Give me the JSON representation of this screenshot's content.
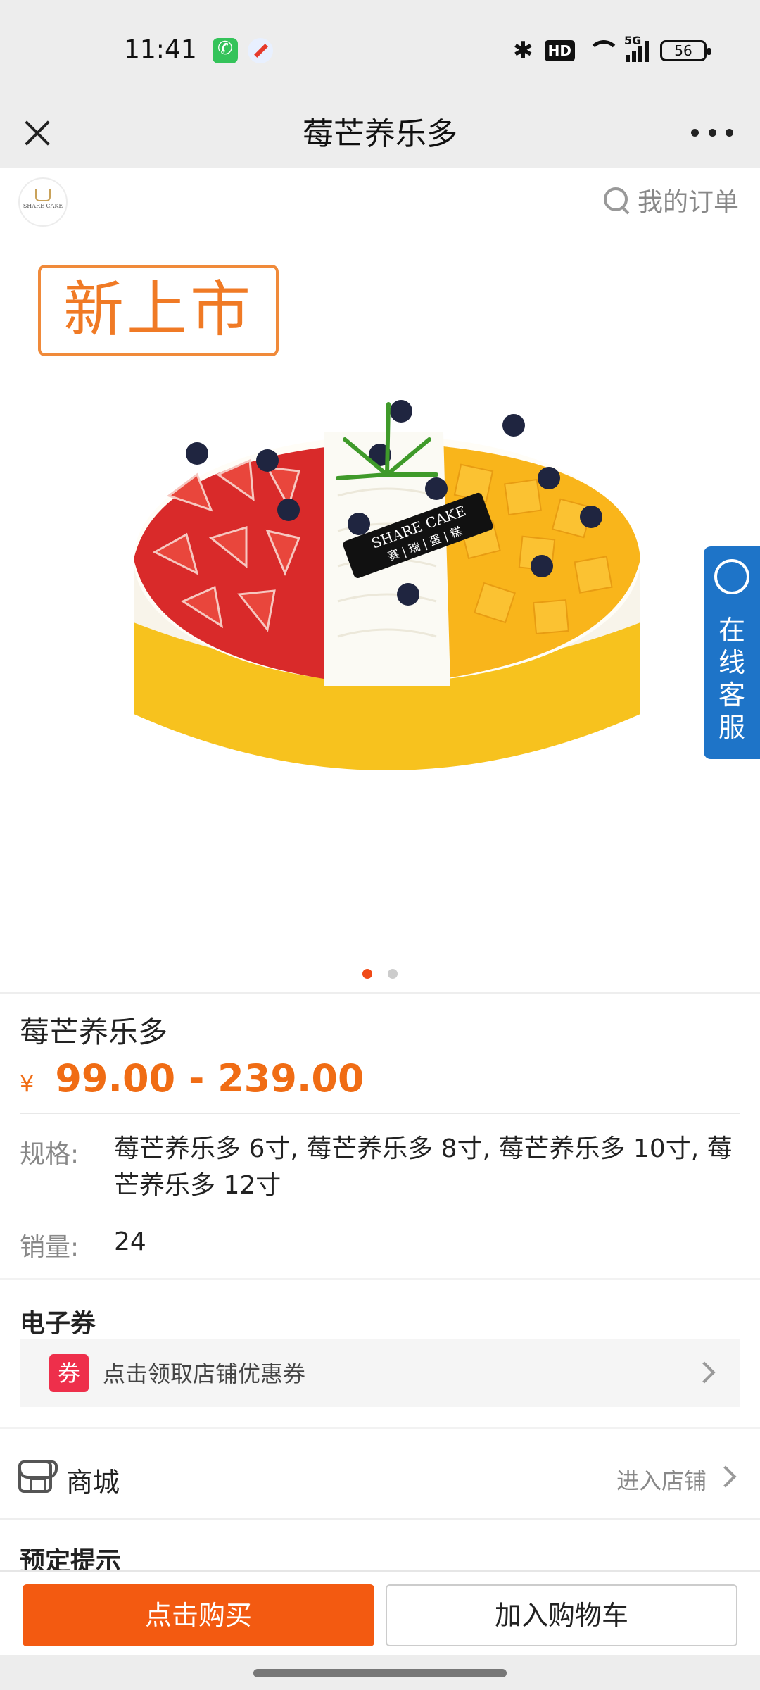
{
  "status_bar": {
    "time": "11:41",
    "hd_label": "HD",
    "network_label": "5G",
    "battery": "56",
    "icons": [
      "phone-app-icon",
      "compass-app-icon",
      "bluetooth-icon",
      "hd-icon",
      "wifi-icon",
      "signal-5g-icon",
      "battery-icon"
    ]
  },
  "title_bar": {
    "title": "莓芒养乐多"
  },
  "shop_header": {
    "logo_text": "SHARE CAKE",
    "my_orders": "我的订单"
  },
  "hero": {
    "badge": "新上市",
    "cake_label": "SHARE CAKE",
    "cake_label_cn": "赛 | 瑞 | 蛋 | 糕",
    "customer_service": "在线客服",
    "slide_count": 2,
    "active_slide": 1
  },
  "product": {
    "name": "莓芒养乐多",
    "currency": "¥",
    "price_range": "99.00 - 239.00",
    "spec_label": "规格:",
    "spec_value": "莓芒养乐多 6寸, 莓芒养乐多 8寸, 莓芒养乐多 10寸, 莓芒养乐多 12寸",
    "sales_label": "销量:",
    "sales_value": "24"
  },
  "coupon": {
    "section_title": "电子券",
    "tag": "券",
    "text": "点击领取店铺优惠券"
  },
  "store": {
    "label": "商城",
    "enter": "进入店铺"
  },
  "notice": {
    "title": "预定提示"
  },
  "actions": {
    "buy": "点击购买",
    "add_to_cart": "加入购物车"
  },
  "colors": {
    "accent": "#f35a11",
    "price": "#f06c14",
    "badge": "#f07a25",
    "coupon_tag": "#ee2f4b",
    "service": "#1e74c8"
  }
}
